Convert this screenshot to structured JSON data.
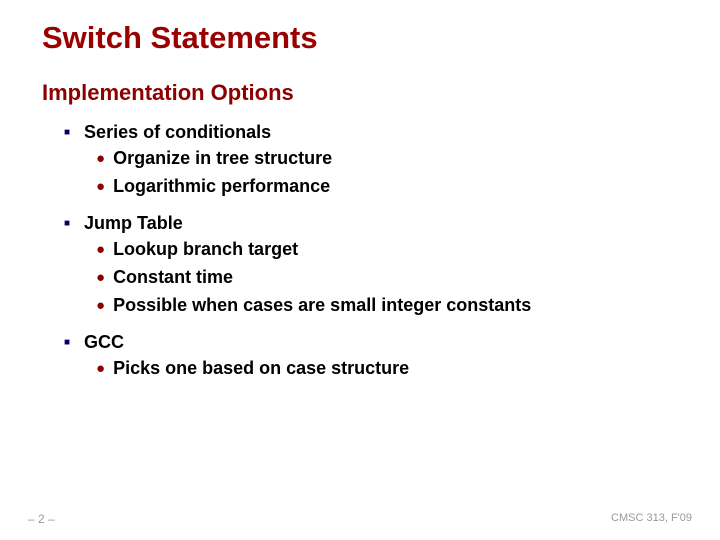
{
  "title": "Switch Statements",
  "section": "Implementation Options",
  "items": [
    {
      "head": "Series of conditionals",
      "subs": [
        "Organize in tree structure",
        "Logarithmic performance"
      ]
    },
    {
      "head": "Jump Table",
      "subs": [
        "Lookup branch target",
        "Constant time",
        "Possible when cases are small integer constants"
      ]
    },
    {
      "head": "GCC",
      "subs": [
        "Picks one based on case structure"
      ]
    }
  ],
  "footer": {
    "left": "– 2 –",
    "right": "CMSC 313, F'09"
  }
}
